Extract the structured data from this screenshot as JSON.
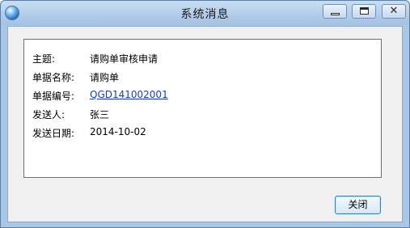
{
  "window": {
    "title": "系统消息",
    "controls": {
      "minimize": "minimize",
      "maximize": "maximize",
      "close": "✕"
    }
  },
  "message": {
    "fields": [
      {
        "label": "主题:",
        "value": "请购单审核申请"
      },
      {
        "label": "单据名称:",
        "value": "请购单"
      },
      {
        "label": "单据编号:",
        "value": "QGD141002001"
      },
      {
        "label": "发送人:",
        "value": "张三"
      },
      {
        "label": "发送日期:",
        "value": "2014-10-02"
      }
    ]
  },
  "footer": {
    "close_label": "关闭"
  }
}
